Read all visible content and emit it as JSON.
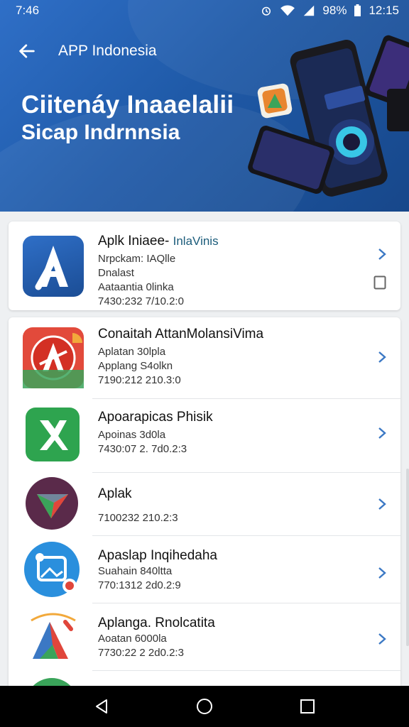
{
  "status": {
    "time": "7:46",
    "battery": "98%",
    "clock": "12:15"
  },
  "header": {
    "title": "APP Indonesia"
  },
  "hero": {
    "title": "Ciitenáy Inaaelalii",
    "subtitle": "Sicap Indrnnsia"
  },
  "featured": {
    "name_a": "Aplk Iniaee- ",
    "name_b": "InlaVinis",
    "line1": "Nrpckam: IAQlle",
    "line2": "Dnalast",
    "line3": "Aataantia 0linka",
    "line4": "7430:232 7/10.2:0"
  },
  "apps": [
    {
      "name": "Conaitah AttanMolansiVima",
      "line1": "Aplatan 30lpla",
      "line2": "Applang S4olkn",
      "line3": "7190:212 210.3:0"
    },
    {
      "name": "Apoarapicas Phisik",
      "line1": "Apoinas 3d0la",
      "line2": "7430:07 2. 7d0.2:3"
    },
    {
      "name": "Aplak",
      "line1": "7100232 210.2:3"
    },
    {
      "name": "Apaslap Inqihedaha",
      "line1": "Suahain 840ltta",
      "line2": "770:1312 2d0.2:9"
    },
    {
      "name": "Aplanga. Rnolcatita",
      "line1": "Aoatan 6000la",
      "line2": "7730:22 2 2d0.2:3"
    }
  ],
  "colors": {
    "hero": "#1f5aa8",
    "chevron": "#3b78c4"
  }
}
